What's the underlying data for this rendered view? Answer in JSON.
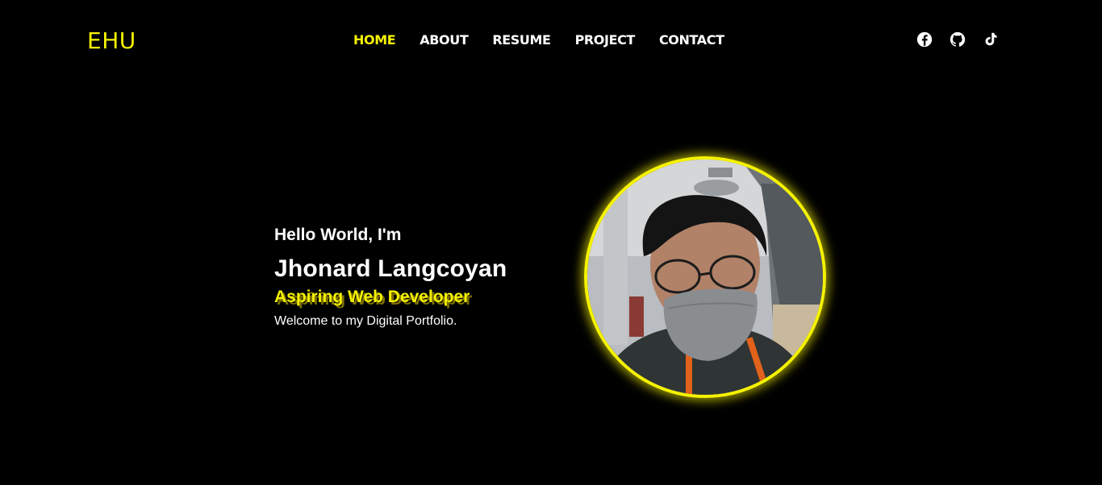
{
  "header": {
    "logo": "EHU",
    "nav": [
      {
        "label": "HOME",
        "active": true
      },
      {
        "label": "ABOUT",
        "active": false
      },
      {
        "label": "RESUME",
        "active": false
      },
      {
        "label": "PROJECT",
        "active": false
      },
      {
        "label": "CONTACT",
        "active": false
      }
    ],
    "socials": [
      "facebook-icon",
      "github-icon",
      "tiktok-icon"
    ]
  },
  "hero": {
    "greeting": "Hello World, I'm",
    "name": "Jhonard Langcoyan",
    "role": "Aspiring Web Developer",
    "welcome": "Welcome to my Digital Portfolio."
  },
  "colors": {
    "background": "#000000",
    "accent": "#f5f200",
    "text": "#ffffff"
  }
}
